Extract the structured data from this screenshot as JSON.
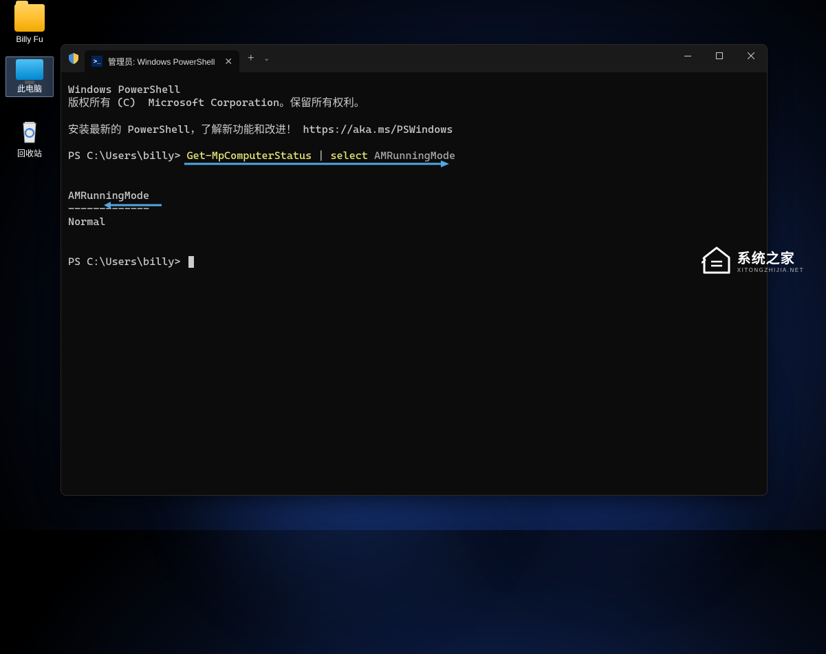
{
  "desktop": {
    "icons": [
      {
        "name": "user-folder",
        "label": "Billy Fu"
      },
      {
        "name": "this-pc",
        "label": "此电脑"
      },
      {
        "name": "recycle-bin",
        "label": "回收站"
      }
    ]
  },
  "terminal": {
    "tab": {
      "title": "管理员: Windows PowerShell"
    },
    "output": {
      "header1": "Windows PowerShell",
      "header2": "版权所有 (C)  Microsoft Corporation。保留所有权利。",
      "install_hint_prefix": "安装最新的 PowerShell，了解新功能和改进！ ",
      "install_hint_url": "https://aka.ms/PSWindows",
      "prompt1": "PS C:\\Users\\billy> ",
      "command_part1": "Get-MpComputerStatus",
      "command_pipe": " | ",
      "command_part2": "select",
      "command_arg": " AMRunningMode",
      "result_header": "AMRunningMode",
      "result_divider": "-------------",
      "result_value": "Normal",
      "prompt2": "PS C:\\Users\\billy> "
    }
  },
  "watermark": {
    "main": "系统之家",
    "sub": "XITONGZHIJIA.NET"
  }
}
